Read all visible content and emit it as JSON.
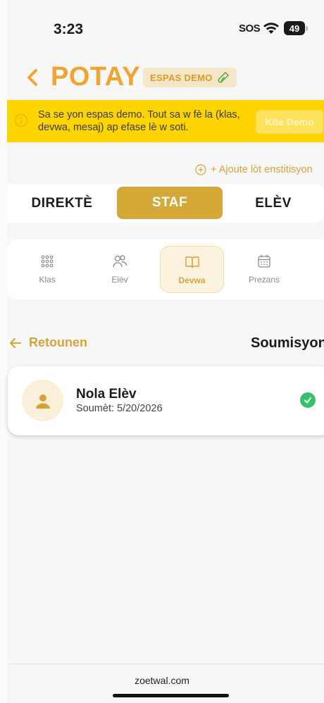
{
  "status_bar": {
    "time": "3:23",
    "sos": "SOS",
    "battery": "49"
  },
  "header": {
    "title": "POTAY",
    "demo_badge": "ESPAS DEMO"
  },
  "banner": {
    "text": "Sa se yon espas demo. Tout sa w fè la (klas, devwa, mesaj) ap efase lè w soti.",
    "exit_label": "Kite Demo"
  },
  "add_institution": "+ Ajoute lòt enstitisyon",
  "roles": [
    {
      "label": "DIREKTÈ",
      "active": false
    },
    {
      "label": "STAF",
      "active": true
    },
    {
      "label": "ELÈV",
      "active": false
    }
  ],
  "features": [
    {
      "label": "Klas",
      "icon": "grid-dots-icon"
    },
    {
      "label": "Elèv",
      "icon": "users-icon"
    },
    {
      "label": "Devwa",
      "icon": "book-icon",
      "active": true
    },
    {
      "label": "Prezans",
      "icon": "calendar-icon"
    }
  ],
  "section": {
    "back_label": "Retounen",
    "title": "Soumisyon"
  },
  "submission": {
    "name": "Nola Elèv",
    "submitted": "Soumèt: 5/20/2026",
    "status_icon": "check-circle-icon"
  },
  "footer": {
    "domain": "zoetwal.com"
  },
  "colors": {
    "accent": "#f0a531",
    "gold": "#d3a838",
    "banner": "#fdd400",
    "success": "#34c36a"
  }
}
